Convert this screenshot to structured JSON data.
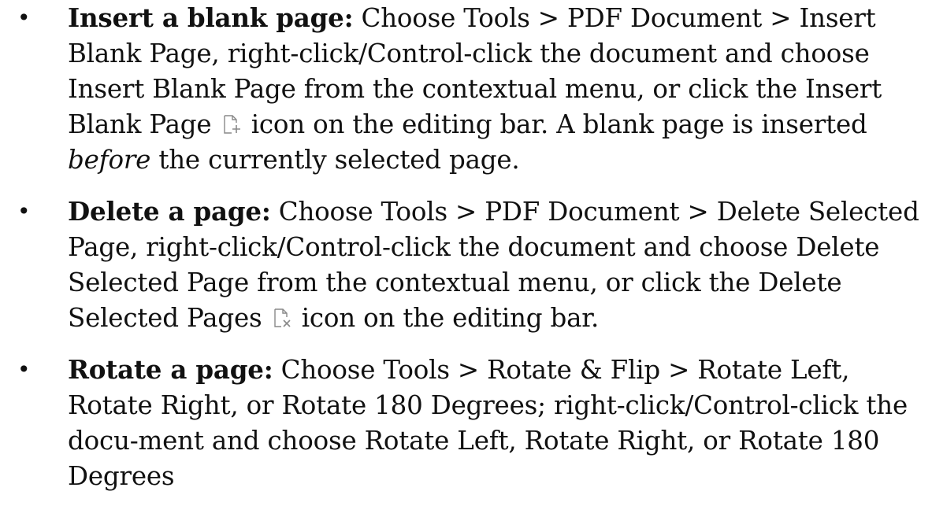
{
  "items": [
    {
      "term": "Insert a blank page:",
      "text_before_icon": " Choose Tools > PDF Document > Insert Blank Page, right-click/Control-click the document and choose Insert Blank Page from the contextual menu, or click the Insert Blank Page ",
      "icon": "insert-blank-page-icon",
      "text_after_icon": " icon on the editing bar. A blank page is inserted ",
      "emphasis": "before",
      "text_end": " the currently selected page."
    },
    {
      "term": "Delete a page:",
      "text_before_icon": " Choose Tools > PDF Document > Delete Selected Page, right-click/Control-click the document and choose Delete Selected Page from the contextual menu, or click the Delete Selected Pages ",
      "icon": "delete-selected-pages-icon",
      "text_after_icon": " icon on the editing bar."
    },
    {
      "term": "Rotate a page:",
      "text": " Choose Tools > Rotate & Flip > Rotate Left, Rotate Right, or Rotate 180 Degrees; right-click/Control-click the docu-ment and choose Rotate Left, Rotate Right, or Rotate 180 Degrees"
    }
  ],
  "bullet_glyph": "•"
}
